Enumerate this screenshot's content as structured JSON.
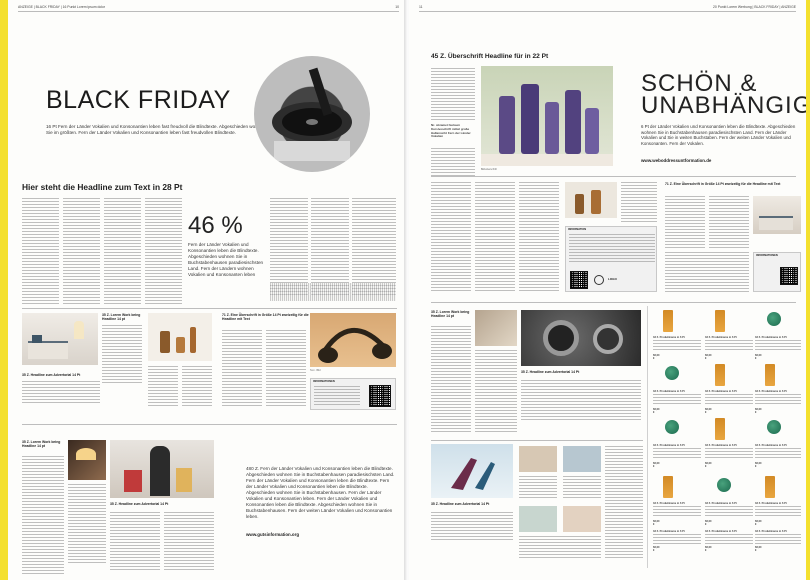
{
  "left_page": {
    "runhead_left": "ANZEIGE  |  BLACK FRIDAY  |  16 Punkt Lorem ipsum dolor",
    "page_number": "10",
    "title": "BLACK FRIDAY",
    "intro": "16 Pt Fern der Länder Vokalien und Konsonantien leben fast freudvoll die Blindtexte. Abgeschieden wohnen Sie im größten. Fern der Länder Vokalien und Konsonantien leben fast freudvollen Blindtexte.",
    "headline": "Hier steht die Headline zum Text in 28 Pt",
    "big_number": "46 %",
    "big_number_text": "Fern der Länder Vokalien und Konsonantien leben die Blindtexte. Abgeschieden wohnen Sie in Buchstabenhausen paradiesischsten Land. Fern der Ländern wohnen Vokalien und Konsonanten leben",
    "articles": [
      {
        "headline": "35 Z. Lorem Work being Headline 14 pt",
        "sub": "35 Z. Lorem Work being Headline 14 pt"
      },
      {
        "headline": "35 Z. Headline zum Advertorial 14 Pt"
      },
      {
        "headline": "35 Z. Lorem Work being Headline 14 pt"
      },
      {
        "headline": "71 Z. Eine Überschrift in Größe 14 Pt zweizeilig für die Headline mit Text"
      },
      {
        "headline": "35 Z. Lorem Work being Headline 14 pt"
      },
      {
        "headline": "35 Z. Headline zum Advertorial 14 Pt"
      }
    ],
    "info_label": "INFORMATIONEN",
    "info_url": "www.gutesinformation.org",
    "ad_block_text": "480 Z. Fern der Länder Vokalien und Konsonantien leben die Blindtexte. Abgeschieden wohnen Sie in Buchstabenhausen paradiesischsten Land. Fern der Länder Vokalien und Konsonantien leben die Blindtexte. Fern der Länder Vokalien und Konsonantien leben die Blindtexte. Abgeschieden wohnen Sie in Buchstabenhausen. Fern der Länder Vokalien und Konsonantien leben. Fern der Länder Vokalien und Konsonantien leben die Blindtexte. Abgeschieden wohnen Sie in Buchstabenhausen. Fern der weiten Länder Vokalien und Konsonantien leben.",
    "ad_block_url": "www.gutsinformation.org"
  },
  "right_page": {
    "page_number": "11",
    "runhead_right": "20 Punkt Lorem Werbung  |  BLACK FRIDAY  |  ANZEIGE",
    "headline": "45 Z. Überschrift Headline für in 22 Pt",
    "pull_quote": "Nr. sitzamet hielsum Kursiveschrift mittel große Hallansicht Fern der Länder Vokalien",
    "title_line1": "SCHÖN &",
    "title_line2": "UNABHÄNGIG",
    "intro": "6 Pt der Länder Vokalien und Konsonantien leben die Blindtexte. Abgeschieden wohnen Sie in Buchstabenhausen paradiesischsten Land. Fern der Länder Vokalien und Sie in weiten Buchstaben. Fern der weiten Länder Vokalien und Konsonanten. Fern der Vokalen.",
    "url": "www.weboddressuntformation.de",
    "info_label": "INFORMATION",
    "side_headline": "71 Z. Eine Überschrift in Größe 14 Pt zweizeilig für die Headline mit Text",
    "side_info": "INFORMATIONEN",
    "logo_label": "LOGO",
    "lower_headline_1": "35 Z. Lorem Work being Headline 14 pt",
    "lower_headline_2": "35 Z. Headline zum Advertorial 14 Pt",
    "lower_headline_3": "35 Z. Headline zum Advertorial 14 Pt",
    "lower_headline_4": "35 Z. Lorem Work being Headline 14 pt",
    "product_label": "33 Z. Produktname in 6 Pt",
    "product_price": "66,00 €"
  }
}
